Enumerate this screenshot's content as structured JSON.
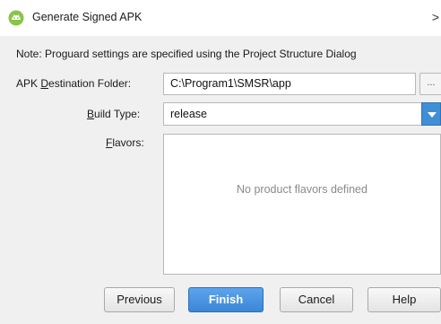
{
  "window": {
    "title": "Generate Signed APK",
    "close_glyph": ">",
    "app_icon": "android-icon"
  },
  "note": "Note: Proguard settings are specified using the Project Structure Dialog",
  "destination": {
    "label_pre": "APK ",
    "label_mnemonic": "D",
    "label_post": "estination Folder:",
    "value": "C:\\Program1\\SMSR\\app",
    "browse_label": "..."
  },
  "build_type": {
    "label_mnemonic": "B",
    "label_post": "uild Type:",
    "value": "release",
    "dropdown_icon": "chevron-down-icon"
  },
  "flavors": {
    "label_mnemonic": "F",
    "label_post": "lavors:",
    "empty_text": "No product flavors defined"
  },
  "buttons": {
    "previous": "Previous",
    "finish": "Finish",
    "cancel": "Cancel",
    "help": "Help"
  },
  "colors": {
    "accent": "#3b86d8",
    "dialog_bg": "#f0f0f0",
    "placeholder_text": "#8a8a8a"
  }
}
